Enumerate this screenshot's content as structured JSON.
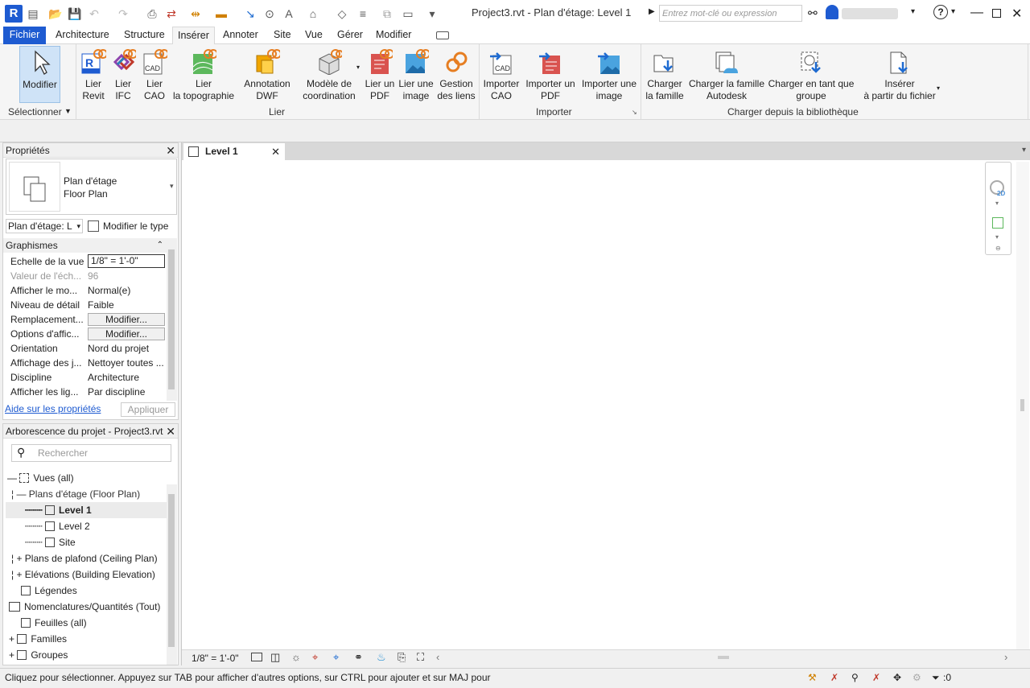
{
  "app": {
    "logo": "R",
    "title": "Project3.rvt - Plan d'étage: Level 1",
    "search_placeholder": "Entrez mot-clé ou expression"
  },
  "tabs": [
    "Fichier",
    "Architecture",
    "Structure",
    "Insérer",
    "Annoter",
    "Site",
    "Vue",
    "Gérer",
    "Modifier"
  ],
  "ribbon": {
    "modify": "Modifier",
    "select_panel": "Sélectionner",
    "link": [
      {
        "label": "Lier\nRevit",
        "icon": "revit-link-icon"
      },
      {
        "label": "Lier\nIFC",
        "icon": "ifc-link-icon"
      },
      {
        "label": "Lier\nCAO",
        "icon": "cad-link-icon"
      },
      {
        "label": "Lier\nla topographie",
        "icon": "topography-link-icon"
      },
      {
        "label": "Annotation\nDWF",
        "icon": "dwf-markup-icon"
      },
      {
        "label": "Modèle de\ncoordination",
        "icon": "coordination-model-icon"
      },
      {
        "label": "Lier un\nPDF",
        "icon": "pdf-link-icon"
      },
      {
        "label": "Lier une\nimage",
        "icon": "image-link-icon"
      },
      {
        "label": "Gestion\ndes liens",
        "icon": "manage-links-icon"
      }
    ],
    "link_panel": "Lier",
    "import": [
      {
        "label": "Importer\nCAO",
        "icon": "import-cad-icon"
      },
      {
        "label": "Importer un\nPDF",
        "icon": "import-pdf-icon"
      },
      {
        "label": "Importer une\nimage",
        "icon": "import-image-icon"
      }
    ],
    "import_panel": "Importer",
    "library": [
      {
        "label": "Charger\nla famille",
        "icon": "load-family-icon"
      },
      {
        "label": "Charger la famille\nAutodesk",
        "icon": "autodesk-family-icon"
      },
      {
        "label": "Charger en tant que\ngroupe",
        "icon": "load-group-icon"
      },
      {
        "label": "Insérer\nà partir du fichier",
        "icon": "insert-file-icon"
      }
    ],
    "library_panel": "Charger depuis la bibliothèque"
  },
  "properties": {
    "title": "Propriétés",
    "type_name": "Plan d'étage",
    "type_sub": "Floor Plan",
    "selector": "Plan d'étage: L",
    "edit_type": "Modifier le type",
    "section": "Graphismes",
    "rows": [
      {
        "k": "Echelle de la vue",
        "v": "1/8\" = 1'-0\""
      },
      {
        "k": "Valeur de l'éch...",
        "v": "96"
      },
      {
        "k": "Afficher le mo...",
        "v": "Normal(e)"
      },
      {
        "k": "Niveau de détail",
        "v": "Faible"
      },
      {
        "k": "Remplacement...",
        "v": "Modifier..."
      },
      {
        "k": "Options d'affic...",
        "v": "Modifier..."
      },
      {
        "k": "Orientation",
        "v": "Nord du projet"
      },
      {
        "k": "Affichage des j...",
        "v": "Nettoyer toutes ..."
      },
      {
        "k": "Discipline",
        "v": "Architecture"
      },
      {
        "k": "Afficher les lig...",
        "v": "Par discipline"
      }
    ],
    "help": "Aide sur les propriétés",
    "apply": "Appliquer"
  },
  "browser": {
    "title": "Arborescence du projet - Project3.rvt",
    "search_placeholder": "Rechercher",
    "items": [
      "Vues (all)",
      "Plans d'étage (Floor Plan)",
      "Level 1",
      "Level 2",
      "Site",
      "Plans de plafond (Ceiling Plan)",
      "Elévations (Building Elevation)",
      "Légendes",
      "Nomenclatures/Quantités (Tout)",
      "Feuilles (all)",
      "Familles",
      "Groupes"
    ]
  },
  "view": {
    "tab": "Level 1",
    "scale": "1/8\" = 1'-0\""
  },
  "status": {
    "text": "Cliquez pour sélectionner. Appuyez sur TAB pour afficher d'autres options, sur CTRL pour ajouter et sur MAJ pour",
    "filter_count": ":0"
  }
}
